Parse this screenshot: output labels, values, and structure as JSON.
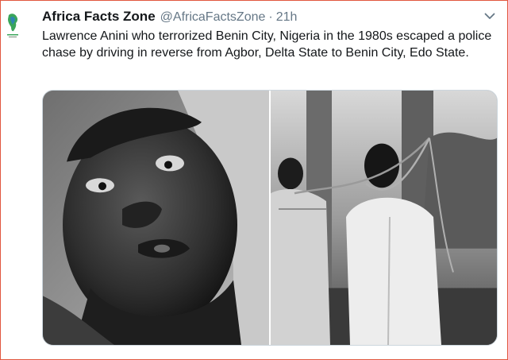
{
  "tweet": {
    "display_name": "Africa Facts Zone",
    "handle": "@AfricaFactsZone",
    "separator": "·",
    "time": "21h",
    "text": "Lawrence Anini who terrorized Benin City, Nigeria in the 1980s escaped a police chase by driving in reverse from Agbor, Delta State to Benin City, Edo State.",
    "media": [
      {
        "description": "black-and-white close-up photo of a man's face"
      },
      {
        "description": "black-and-white photo of two men with ropes around their necks"
      }
    ]
  },
  "icons": {
    "avatar": "africa-map-logo-icon",
    "menu": "chevron-down-icon"
  },
  "colors": {
    "text": "#14171a",
    "secondary": "#657786",
    "border": "#ccd6dd",
    "frame": "#e1573f"
  }
}
